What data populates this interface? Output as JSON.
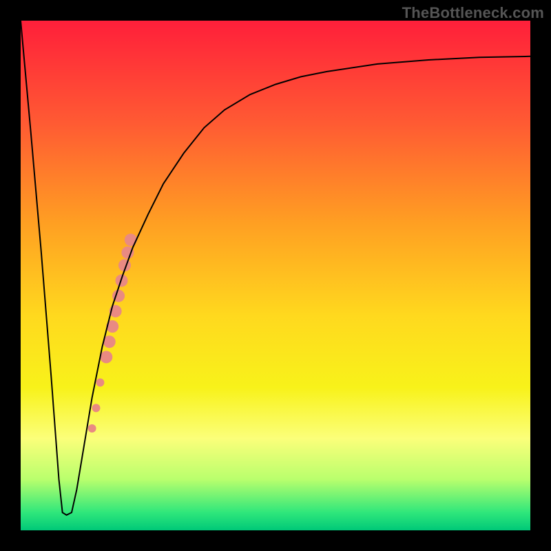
{
  "watermark": "TheBottleneck.com",
  "chart_data": {
    "type": "line",
    "title": "",
    "xlabel": "",
    "ylabel": "",
    "xlim": [
      0,
      100
    ],
    "ylim": [
      0,
      100
    ],
    "grid": false,
    "legend": false,
    "background": {
      "kind": "vertical-gradient",
      "stops": [
        {
          "pos": 0.0,
          "color": "#ff1f3a"
        },
        {
          "pos": 0.2,
          "color": "#ff5a33"
        },
        {
          "pos": 0.4,
          "color": "#ffa022"
        },
        {
          "pos": 0.58,
          "color": "#ffd91e"
        },
        {
          "pos": 0.72,
          "color": "#f8f21a"
        },
        {
          "pos": 0.82,
          "color": "#fbff7a"
        },
        {
          "pos": 0.9,
          "color": "#b9ff6d"
        },
        {
          "pos": 0.965,
          "color": "#2fe77b"
        },
        {
          "pos": 1.0,
          "color": "#00c878"
        }
      ]
    },
    "series": [
      {
        "name": "bottleneck-curve",
        "color": "#000000",
        "stroke_width": 2,
        "x": [
          0.0,
          2.0,
          4.0,
          6.0,
          7.5,
          8.2,
          9.0,
          10.0,
          11.0,
          12.0,
          14.0,
          16.0,
          18.0,
          20.0,
          22.0,
          25.0,
          28.0,
          32.0,
          36.0,
          40.0,
          45.0,
          50.0,
          55.0,
          60.0,
          70.0,
          80.0,
          90.0,
          100.0
        ],
        "y": [
          100.0,
          78.0,
          55.0,
          30.0,
          10.0,
          3.5,
          3.0,
          3.5,
          8.0,
          14.0,
          26.0,
          36.0,
          44.0,
          50.0,
          55.5,
          62.0,
          68.0,
          74.0,
          79.0,
          82.5,
          85.5,
          87.5,
          89.0,
          90.0,
          91.5,
          92.3,
          92.8,
          93.0
        ]
      }
    ],
    "markers": {
      "name": "highlight-band",
      "color": "#e98a82",
      "points": [
        {
          "x": 14.0,
          "y": 20.0,
          "r": 6
        },
        {
          "x": 14.8,
          "y": 24.0,
          "r": 6
        },
        {
          "x": 15.6,
          "y": 29.0,
          "r": 6
        },
        {
          "x": 16.8,
          "y": 34.0,
          "r": 9
        },
        {
          "x": 17.4,
          "y": 37.0,
          "r": 9
        },
        {
          "x": 18.0,
          "y": 40.0,
          "r": 9
        },
        {
          "x": 18.6,
          "y": 43.0,
          "r": 9
        },
        {
          "x": 19.2,
          "y": 46.0,
          "r": 9
        },
        {
          "x": 19.8,
          "y": 49.0,
          "r": 9
        },
        {
          "x": 20.4,
          "y": 52.0,
          "r": 9
        },
        {
          "x": 21.0,
          "y": 54.5,
          "r": 9
        },
        {
          "x": 21.6,
          "y": 57.0,
          "r": 9
        }
      ]
    }
  }
}
